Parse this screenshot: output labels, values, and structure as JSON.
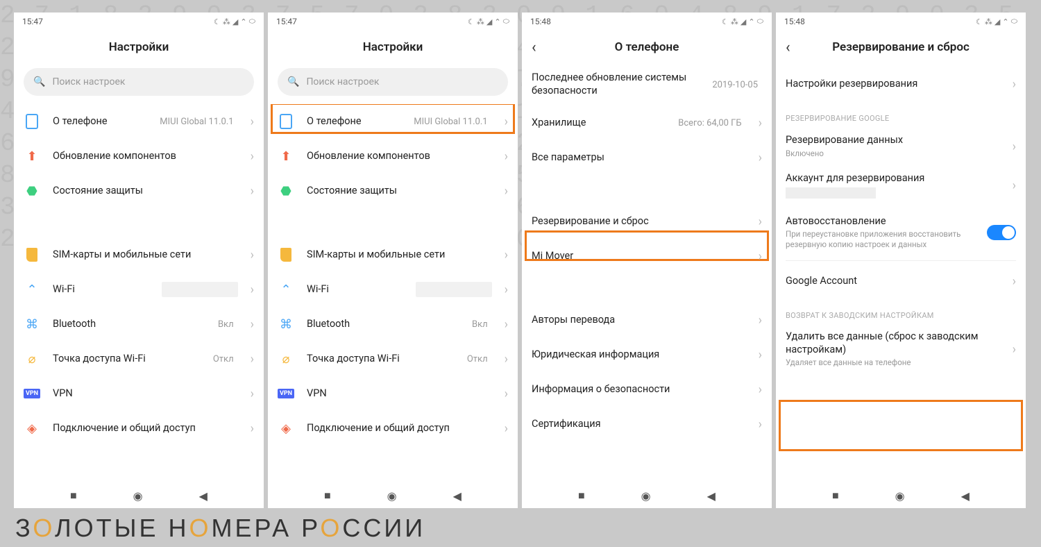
{
  "bg_numbers": "271829037570283091604891729035261903047226109405324890174530982254471085123712604329410609421637052837046132067520148399629825414734523203480163104804825304270936401583946187230454303040748561538616452128146546236353126400126066",
  "status": {
    "time_a": "15:47",
    "time_b": "15:48",
    "icons": [
      "☾",
      "⁂",
      "◢",
      "◠",
      "⊚"
    ]
  },
  "headers": {
    "settings": "Настройки",
    "about": "О телефоне",
    "backup": "Резервирование и сброс"
  },
  "search_placeholder": "Поиск настроек",
  "settings_rows": {
    "about": "О телефоне",
    "about_value": "MIUI Global 11.0.1",
    "components": "Обновление компонентов",
    "security_status": "Состояние защиты",
    "sim": "SIM-карты и мобильные сети",
    "wifi": "Wi-Fi",
    "bluetooth": "Bluetooth",
    "bluetooth_value": "Вкл",
    "hotspot": "Точка доступа Wi-Fi",
    "hotspot_value": "Откл",
    "vpn": "VPN",
    "share": "Подключение и общий доступ"
  },
  "about_rows": {
    "security_update": "Последнее обновление системы безопасности",
    "security_update_value": "2019-10-05",
    "storage": "Хранилище",
    "storage_value": "Всего: 64,00 ГБ",
    "all_params": "Все параметры",
    "backup_reset": "Резервирование и сброс",
    "mi_mover": "Mi Mover",
    "translators": "Авторы перевода",
    "legal": "Юридическая информация",
    "security_info": "Информация о безопасности",
    "certification": "Сертификация"
  },
  "backup_rows": {
    "backup_settings": "Настройки резервирования",
    "section_google": "РЕЗЕРВИРОВАНИЕ GOOGLE",
    "data_backup": "Резервирование данных",
    "data_backup_sub": "Включено",
    "backup_account": "Аккаунт для резервирования",
    "auto_restore": "Автовосстановление",
    "auto_restore_sub": "При переустановке приложения восстановить резервную копию настроек и данных",
    "google_account": "Google Account",
    "section_factory": "ВОЗВРАТ К ЗАВОДСКИМ НАСТРОЙКАМ",
    "erase_all": "Удалить все данные (сброс к заводским настройкам)",
    "erase_all_sub": "Удаляет все данные на телефоне"
  },
  "brand": {
    "pre": "З",
    "o1": "О",
    "mid1": "ЛОТЫЕ Н",
    "o2": "О",
    "mid2": "МЕРА Р",
    "o3": "О",
    "end": "ССИИ"
  }
}
